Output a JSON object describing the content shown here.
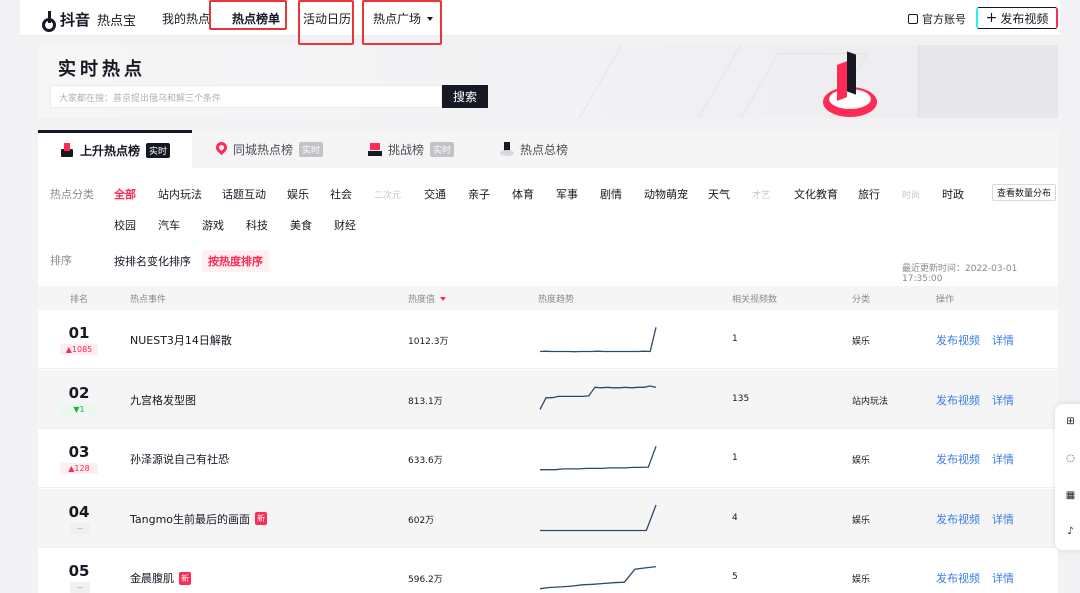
{
  "topbar": {
    "logo_text": "抖音",
    "logo_sub": "热点宝",
    "nav": [
      "我的热点",
      "热点榜单",
      "活动日历",
      "热点广场"
    ],
    "official": "官方账号",
    "publish": "发布视频"
  },
  "banner": {
    "title": "实时热点",
    "search_placeholder": "大家都在搜：普京提出俄乌和解三个条件",
    "search_button": "搜索"
  },
  "tabs": [
    {
      "label": "上升热点榜",
      "tag": "实时"
    },
    {
      "label": "同城热点榜",
      "tag": "实时"
    },
    {
      "label": "挑战榜",
      "tag": "实时"
    },
    {
      "label": "热点总榜",
      "tag": ""
    }
  ],
  "filters": {
    "category_label": "热点分类",
    "categories_row1": [
      "全部",
      "站内玩法",
      "话题互动",
      "娱乐",
      "社会",
      "二次元",
      "交通",
      "亲子",
      "体育",
      "军事",
      "剧情",
      "动物萌宠",
      "天气",
      "才艺",
      "文化教育",
      "旅行",
      "时尚",
      "时政"
    ],
    "categories_row2": [
      "校园",
      "汽车",
      "游戏",
      "科技",
      "美食",
      "财经"
    ],
    "distribution_button": "查看数量分布",
    "sort_label": "排序",
    "sort_options": [
      "按排名变化排序",
      "按热度排序"
    ],
    "updated": "最近更新时间：2022-03-01 17:35:00"
  },
  "table": {
    "columns": [
      "排名",
      "热点事件",
      "热度值",
      "热度趋势",
      "相关视频数",
      "分类",
      "操作"
    ],
    "rows": [
      {
        "rank": "01",
        "delta": "▲1085",
        "event": "NUEST3月14日解散",
        "is_new": false,
        "heat": "1012.3万",
        "videos": "1",
        "category": "娱乐",
        "action1": "发布视频",
        "action2": "详情",
        "trend": [
          0.02,
          0.03,
          0.02,
          0.02,
          0.02,
          0.02,
          0.01,
          0.02,
          0.02,
          0.02,
          0.03,
          0.02,
          0.02,
          0.02,
          0.02,
          0.02,
          0.02,
          0.02,
          0.03,
          0.02,
          0.95
        ]
      },
      {
        "rank": "02",
        "delta": "▼1",
        "event": "九宫格发型图",
        "is_new": false,
        "heat": "813.1万",
        "videos": "135",
        "category": "站内玩法",
        "action1": "发布视频",
        "action2": "详情",
        "trend": [
          0.1,
          0.55,
          0.55,
          0.6,
          0.6,
          0.6,
          0.6,
          0.6,
          0.62,
          0.95,
          0.93,
          0.95,
          0.93,
          0.93,
          0.95,
          0.93,
          0.95,
          0.95,
          1.0,
          0.95
        ]
      },
      {
        "rank": "03",
        "delta": "▲128",
        "event": "孙泽源说自己有社恐",
        "is_new": false,
        "heat": "633.6万",
        "videos": "1",
        "category": "娱乐",
        "action1": "发布视频",
        "action2": "详情",
        "trend": [
          0.05,
          0.05,
          0.05,
          0.08,
          0.08,
          0.08,
          0.1,
          0.1,
          0.1,
          0.12,
          0.12,
          0.12,
          0.14,
          0.14,
          0.15,
          0.95
        ]
      },
      {
        "rank": "04",
        "delta": "--",
        "event": "Tangmo生前最后的画面",
        "is_new": true,
        "heat": "602万",
        "videos": "4",
        "category": "娱乐",
        "action1": "发布视频",
        "action2": "详情",
        "trend": [
          0.02,
          0.02,
          0.02,
          0.02,
          0.02,
          0.02,
          0.02,
          0.02,
          0.02,
          0.02,
          0.02,
          0.02,
          1.0
        ]
      },
      {
        "rank": "05",
        "delta": "--",
        "event": "金晨腹肌",
        "is_new": true,
        "heat": "596.2万",
        "videos": "5",
        "category": "娱乐",
        "action1": "发布视频",
        "action2": "详情",
        "trend": [
          0.05,
          0.1,
          0.12,
          0.15,
          0.2,
          0.22,
          0.25,
          0.28,
          0.3,
          0.8,
          0.85,
          0.9
        ]
      }
    ]
  },
  "side_tools": [
    "expand-icon",
    "chat-icon",
    "qrcode-icon",
    "tiktok-icon"
  ],
  "colors": {
    "accent": "#fe2c55",
    "link": "#3a7ee6",
    "dark": "#161823",
    "annotation": "#e9353a"
  }
}
